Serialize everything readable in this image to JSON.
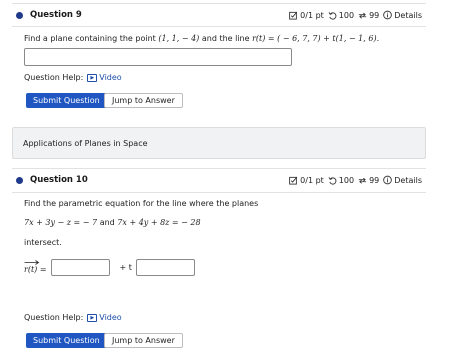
{
  "q9": {
    "title": "Question 9",
    "score": "0/1 pt",
    "attempts": "100",
    "tries": "99",
    "details": "Details",
    "prompt_pre": "Find a plane containing the point",
    "point": "(1, 1, − 4)",
    "prompt_mid": "and the line",
    "line_expr": "r(t) = ( − 6, 7, 7) + t(1, − 1, 6).",
    "answer_value": "",
    "help_label": "Question Help:",
    "video_label": "Video",
    "submit_label": "Submit Question",
    "jump_label": "Jump to Answer"
  },
  "banner": {
    "text": "Applications of Planes in Space"
  },
  "q10": {
    "title": "Question 10",
    "score": "0/1 pt",
    "attempts": "100",
    "tries": "99",
    "details": "Details",
    "prompt": "Find the parametric equation for the line where the planes",
    "eq1": "7x + 3y − z = − 7",
    "and_word": "and",
    "eq2": "7x + 4y + 8z = − 28",
    "intersect": "intersect.",
    "lhs": "r(t) =",
    "plus_t": "+ t",
    "answer1_value": "",
    "answer2_value": "",
    "help_label": "Question Help:",
    "video_label": "Video",
    "submit_label": "Submit Question",
    "jump_label": "Jump to Answer"
  },
  "icons": {
    "score": "checkbox-edit-icon",
    "attempts": "undo-icon",
    "tries": "retry-icon",
    "details": "info-icon",
    "video": "video-play-icon"
  },
  "colors": {
    "accent": "#1f56c2",
    "dot": "#1f3a8a",
    "link": "#1f4fa8",
    "banner_bg": "#f1f2f3"
  }
}
